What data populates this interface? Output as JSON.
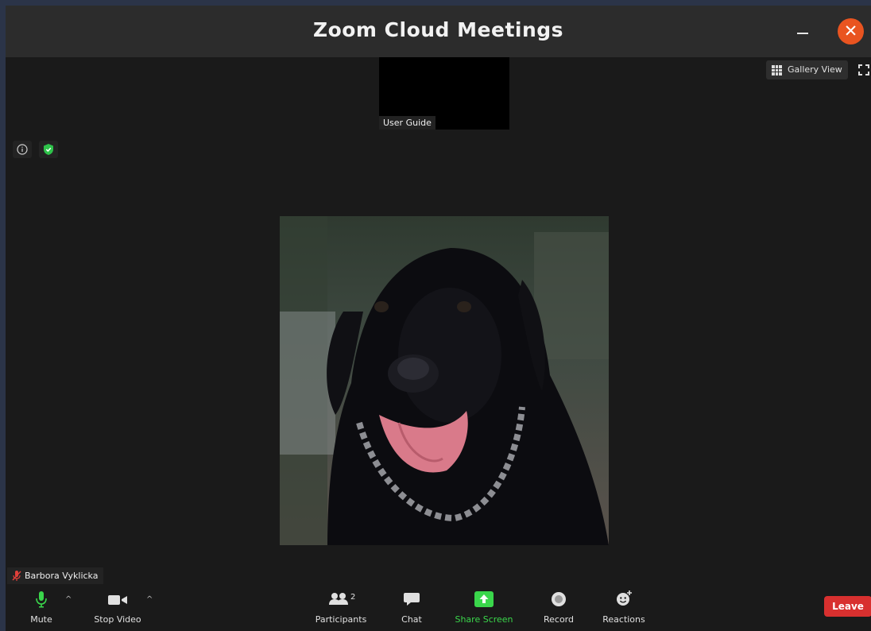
{
  "window": {
    "title": "Zoom Cloud Meetings"
  },
  "strip": {
    "label": "User Guide"
  },
  "view": {
    "gallery_label": "Gallery View"
  },
  "participant": {
    "name": "Barbora Vyklicka"
  },
  "toolbar": {
    "mute": "Mute",
    "stop_video": "Stop Video",
    "participants": "Participants",
    "participants_count": "2",
    "chat": "Chat",
    "share_screen": "Share Screen",
    "record": "Record",
    "reactions": "Reactions",
    "leave": "Leave"
  },
  "colors": {
    "close_button": "#e95420",
    "share_green": "#3ad64b",
    "leave_red": "#d8302f",
    "muted_red": "#e0403a"
  },
  "icons": [
    "info-icon",
    "shield-check-icon",
    "grid-icon",
    "fullscreen-icon",
    "mic-icon",
    "video-camera-icon",
    "participants-icon",
    "chat-icon",
    "share-screen-icon",
    "record-icon",
    "reactions-icon",
    "mic-off-icon",
    "close-icon",
    "minimize-icon"
  ]
}
